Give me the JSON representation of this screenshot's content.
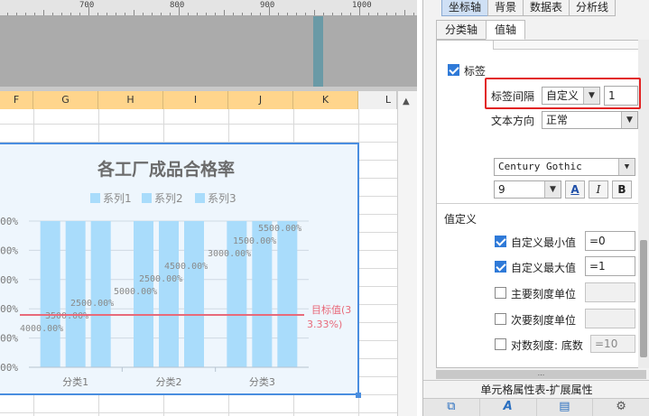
{
  "ruler": {
    "labels": [
      "700",
      "800",
      "900",
      "1000"
    ]
  },
  "sheet": {
    "columns": [
      "F",
      "G",
      "H",
      "I",
      "J",
      "K",
      "L"
    ]
  },
  "chart_data": {
    "type": "bar",
    "title": "各工厂成品合格率",
    "categories": [
      "分类1",
      "分类2",
      "分类3"
    ],
    "series": [
      {
        "name": "系列1",
        "values": [
          1,
          1,
          1
        ]
      },
      {
        "name": "系列2",
        "values": [
          1,
          1,
          1
        ]
      },
      {
        "name": "系列3",
        "values": [
          1,
          1,
          1
        ]
      }
    ],
    "data_labels": [
      [
        "4000.00%",
        "3500.00%",
        "2500.00%"
      ],
      [
        "5000.00%",
        "2500.00%",
        "4500.00%"
      ],
      [
        "3000.00%",
        "1500.00%",
        "5500.00%"
      ]
    ],
    "y_tick_labels": [
      "00%",
      "00%",
      "00%",
      "00%",
      "00%",
      "00%"
    ],
    "ylim": [
      0,
      1
    ],
    "target_line": {
      "value": 0.3333,
      "label_line1": "目标值(3",
      "label_line2": "3.33%)",
      "color": "#e86a7a"
    },
    "bar_color": "#a9dcfb",
    "legend_position": "top"
  },
  "panel": {
    "top_tabs": [
      "坐标轴",
      "背景",
      "数据表",
      "分析线"
    ],
    "sub_tabs": [
      "分类轴",
      "值轴"
    ],
    "label_checkbox": "标签",
    "label_interval": {
      "label": "标签间隔",
      "mode": "自定义",
      "value": "1"
    },
    "text_direction": {
      "label": "文本方向",
      "value": "正常"
    },
    "font_name": "Century Gothic",
    "font_size": "9",
    "format_buttons": {
      "color": "A",
      "italic": "I",
      "bold": "B"
    },
    "value_def": {
      "title": "值定义",
      "custom_min": {
        "label": "自定义最小值",
        "value": "=0",
        "checked": true
      },
      "custom_max": {
        "label": "自定义最大值",
        "value": "=1",
        "checked": true
      },
      "major_unit": {
        "label": "主要刻度单位",
        "value": "",
        "checked": false
      },
      "minor_unit": {
        "label": "次要刻度单位",
        "value": "",
        "checked": false
      },
      "log_scale": {
        "label": "对数刻度: 底数",
        "value": "=10",
        "checked": false
      }
    },
    "bottom_dots": "...",
    "footer_title": "单元格属性表-扩展属性"
  }
}
